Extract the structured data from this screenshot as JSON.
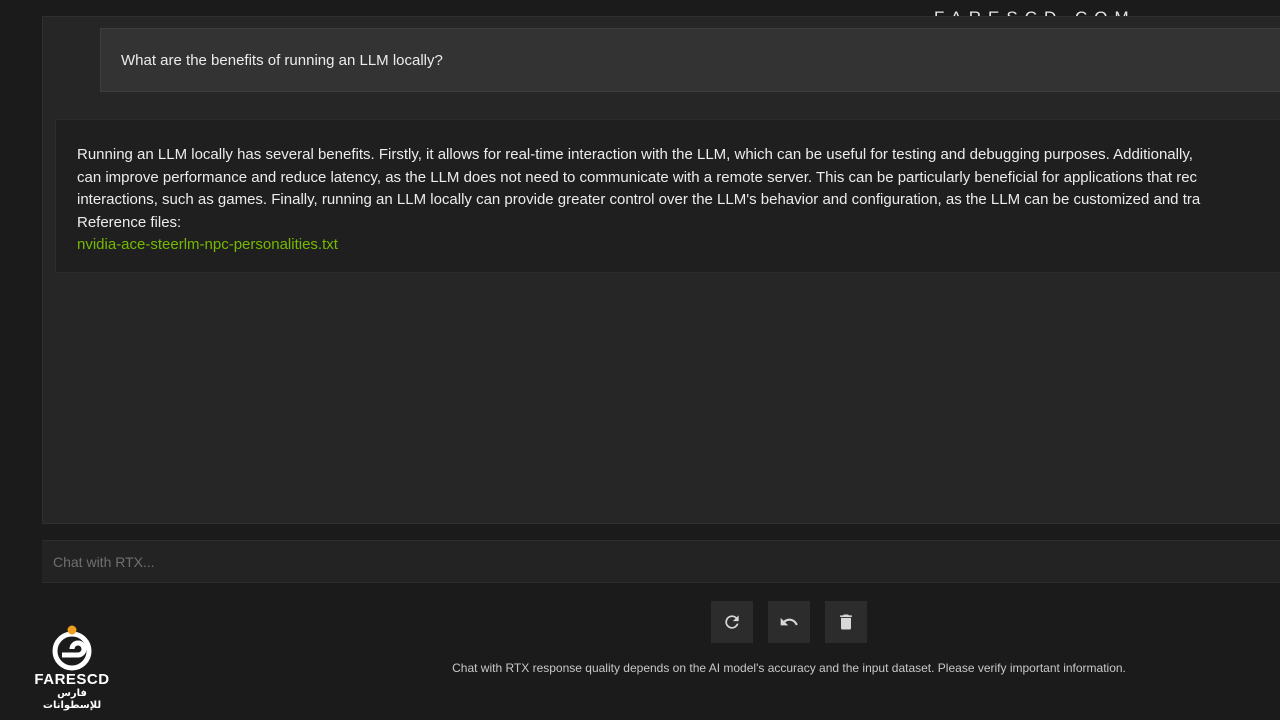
{
  "watermark": "FARESCD.COM",
  "conversation": {
    "user_message": "What are the benefits of running an LLM locally?",
    "assistant_lines": [
      "Running an LLM locally has several benefits. Firstly, it allows for real-time interaction with the LLM, which can be useful for testing and debugging purposes. Additionally,",
      "can improve performance and reduce latency, as the LLM does not need to communicate with a remote server. This can be particularly beneficial for applications that rec",
      "interactions, such as games. Finally, running an LLM locally can provide greater control over the LLM's behavior and configuration, as the LLM can be customized and tra"
    ],
    "reference_label": "Reference files:",
    "reference_file": "nvidia-ace-steerlm-npc-personalities.txt",
    "link_color": "#76b900"
  },
  "input": {
    "placeholder": "Chat with RTX...",
    "value": ""
  },
  "actions": [
    {
      "icon": "refresh-icon"
    },
    {
      "icon": "undo-icon"
    },
    {
      "icon": "trash-icon"
    }
  ],
  "disclaimer": "Chat with RTX response quality depends on the AI model's accuracy and the input dataset. Please verify important information.",
  "logo": {
    "name": "FARESCD",
    "subtitle": "فارس للإسطوانات"
  }
}
